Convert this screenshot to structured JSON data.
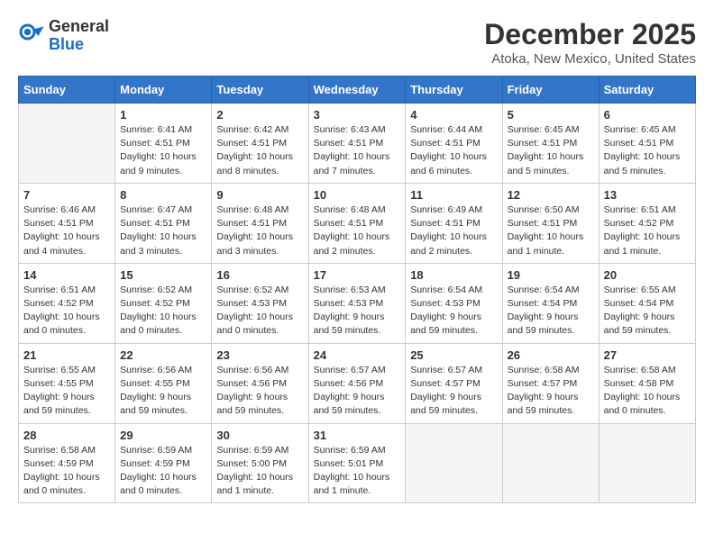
{
  "header": {
    "logo": {
      "general": "General",
      "blue": "Blue"
    },
    "title": "December 2025",
    "location": "Atoka, New Mexico, United States"
  },
  "days_of_week": [
    "Sunday",
    "Monday",
    "Tuesday",
    "Wednesday",
    "Thursday",
    "Friday",
    "Saturday"
  ],
  "weeks": [
    [
      {
        "day": "",
        "info": ""
      },
      {
        "day": "1",
        "info": "Sunrise: 6:41 AM\nSunset: 4:51 PM\nDaylight: 10 hours\nand 9 minutes."
      },
      {
        "day": "2",
        "info": "Sunrise: 6:42 AM\nSunset: 4:51 PM\nDaylight: 10 hours\nand 8 minutes."
      },
      {
        "day": "3",
        "info": "Sunrise: 6:43 AM\nSunset: 4:51 PM\nDaylight: 10 hours\nand 7 minutes."
      },
      {
        "day": "4",
        "info": "Sunrise: 6:44 AM\nSunset: 4:51 PM\nDaylight: 10 hours\nand 6 minutes."
      },
      {
        "day": "5",
        "info": "Sunrise: 6:45 AM\nSunset: 4:51 PM\nDaylight: 10 hours\nand 5 minutes."
      },
      {
        "day": "6",
        "info": "Sunrise: 6:45 AM\nSunset: 4:51 PM\nDaylight: 10 hours\nand 5 minutes."
      }
    ],
    [
      {
        "day": "7",
        "info": "Sunrise: 6:46 AM\nSunset: 4:51 PM\nDaylight: 10 hours\nand 4 minutes."
      },
      {
        "day": "8",
        "info": "Sunrise: 6:47 AM\nSunset: 4:51 PM\nDaylight: 10 hours\nand 3 minutes."
      },
      {
        "day": "9",
        "info": "Sunrise: 6:48 AM\nSunset: 4:51 PM\nDaylight: 10 hours\nand 3 minutes."
      },
      {
        "day": "10",
        "info": "Sunrise: 6:48 AM\nSunset: 4:51 PM\nDaylight: 10 hours\nand 2 minutes."
      },
      {
        "day": "11",
        "info": "Sunrise: 6:49 AM\nSunset: 4:51 PM\nDaylight: 10 hours\nand 2 minutes."
      },
      {
        "day": "12",
        "info": "Sunrise: 6:50 AM\nSunset: 4:51 PM\nDaylight: 10 hours\nand 1 minute."
      },
      {
        "day": "13",
        "info": "Sunrise: 6:51 AM\nSunset: 4:52 PM\nDaylight: 10 hours\nand 1 minute."
      }
    ],
    [
      {
        "day": "14",
        "info": "Sunrise: 6:51 AM\nSunset: 4:52 PM\nDaylight: 10 hours\nand 0 minutes."
      },
      {
        "day": "15",
        "info": "Sunrise: 6:52 AM\nSunset: 4:52 PM\nDaylight: 10 hours\nand 0 minutes."
      },
      {
        "day": "16",
        "info": "Sunrise: 6:52 AM\nSunset: 4:53 PM\nDaylight: 10 hours\nand 0 minutes."
      },
      {
        "day": "17",
        "info": "Sunrise: 6:53 AM\nSunset: 4:53 PM\nDaylight: 9 hours\nand 59 minutes."
      },
      {
        "day": "18",
        "info": "Sunrise: 6:54 AM\nSunset: 4:53 PM\nDaylight: 9 hours\nand 59 minutes."
      },
      {
        "day": "19",
        "info": "Sunrise: 6:54 AM\nSunset: 4:54 PM\nDaylight: 9 hours\nand 59 minutes."
      },
      {
        "day": "20",
        "info": "Sunrise: 6:55 AM\nSunset: 4:54 PM\nDaylight: 9 hours\nand 59 minutes."
      }
    ],
    [
      {
        "day": "21",
        "info": "Sunrise: 6:55 AM\nSunset: 4:55 PM\nDaylight: 9 hours\nand 59 minutes."
      },
      {
        "day": "22",
        "info": "Sunrise: 6:56 AM\nSunset: 4:55 PM\nDaylight: 9 hours\nand 59 minutes."
      },
      {
        "day": "23",
        "info": "Sunrise: 6:56 AM\nSunset: 4:56 PM\nDaylight: 9 hours\nand 59 minutes."
      },
      {
        "day": "24",
        "info": "Sunrise: 6:57 AM\nSunset: 4:56 PM\nDaylight: 9 hours\nand 59 minutes."
      },
      {
        "day": "25",
        "info": "Sunrise: 6:57 AM\nSunset: 4:57 PM\nDaylight: 9 hours\nand 59 minutes."
      },
      {
        "day": "26",
        "info": "Sunrise: 6:58 AM\nSunset: 4:57 PM\nDaylight: 9 hours\nand 59 minutes."
      },
      {
        "day": "27",
        "info": "Sunrise: 6:58 AM\nSunset: 4:58 PM\nDaylight: 10 hours\nand 0 minutes."
      }
    ],
    [
      {
        "day": "28",
        "info": "Sunrise: 6:58 AM\nSunset: 4:59 PM\nDaylight: 10 hours\nand 0 minutes."
      },
      {
        "day": "29",
        "info": "Sunrise: 6:59 AM\nSunset: 4:59 PM\nDaylight: 10 hours\nand 0 minutes."
      },
      {
        "day": "30",
        "info": "Sunrise: 6:59 AM\nSunset: 5:00 PM\nDaylight: 10 hours\nand 1 minute."
      },
      {
        "day": "31",
        "info": "Sunrise: 6:59 AM\nSunset: 5:01 PM\nDaylight: 10 hours\nand 1 minute."
      },
      {
        "day": "",
        "info": ""
      },
      {
        "day": "",
        "info": ""
      },
      {
        "day": "",
        "info": ""
      }
    ]
  ]
}
